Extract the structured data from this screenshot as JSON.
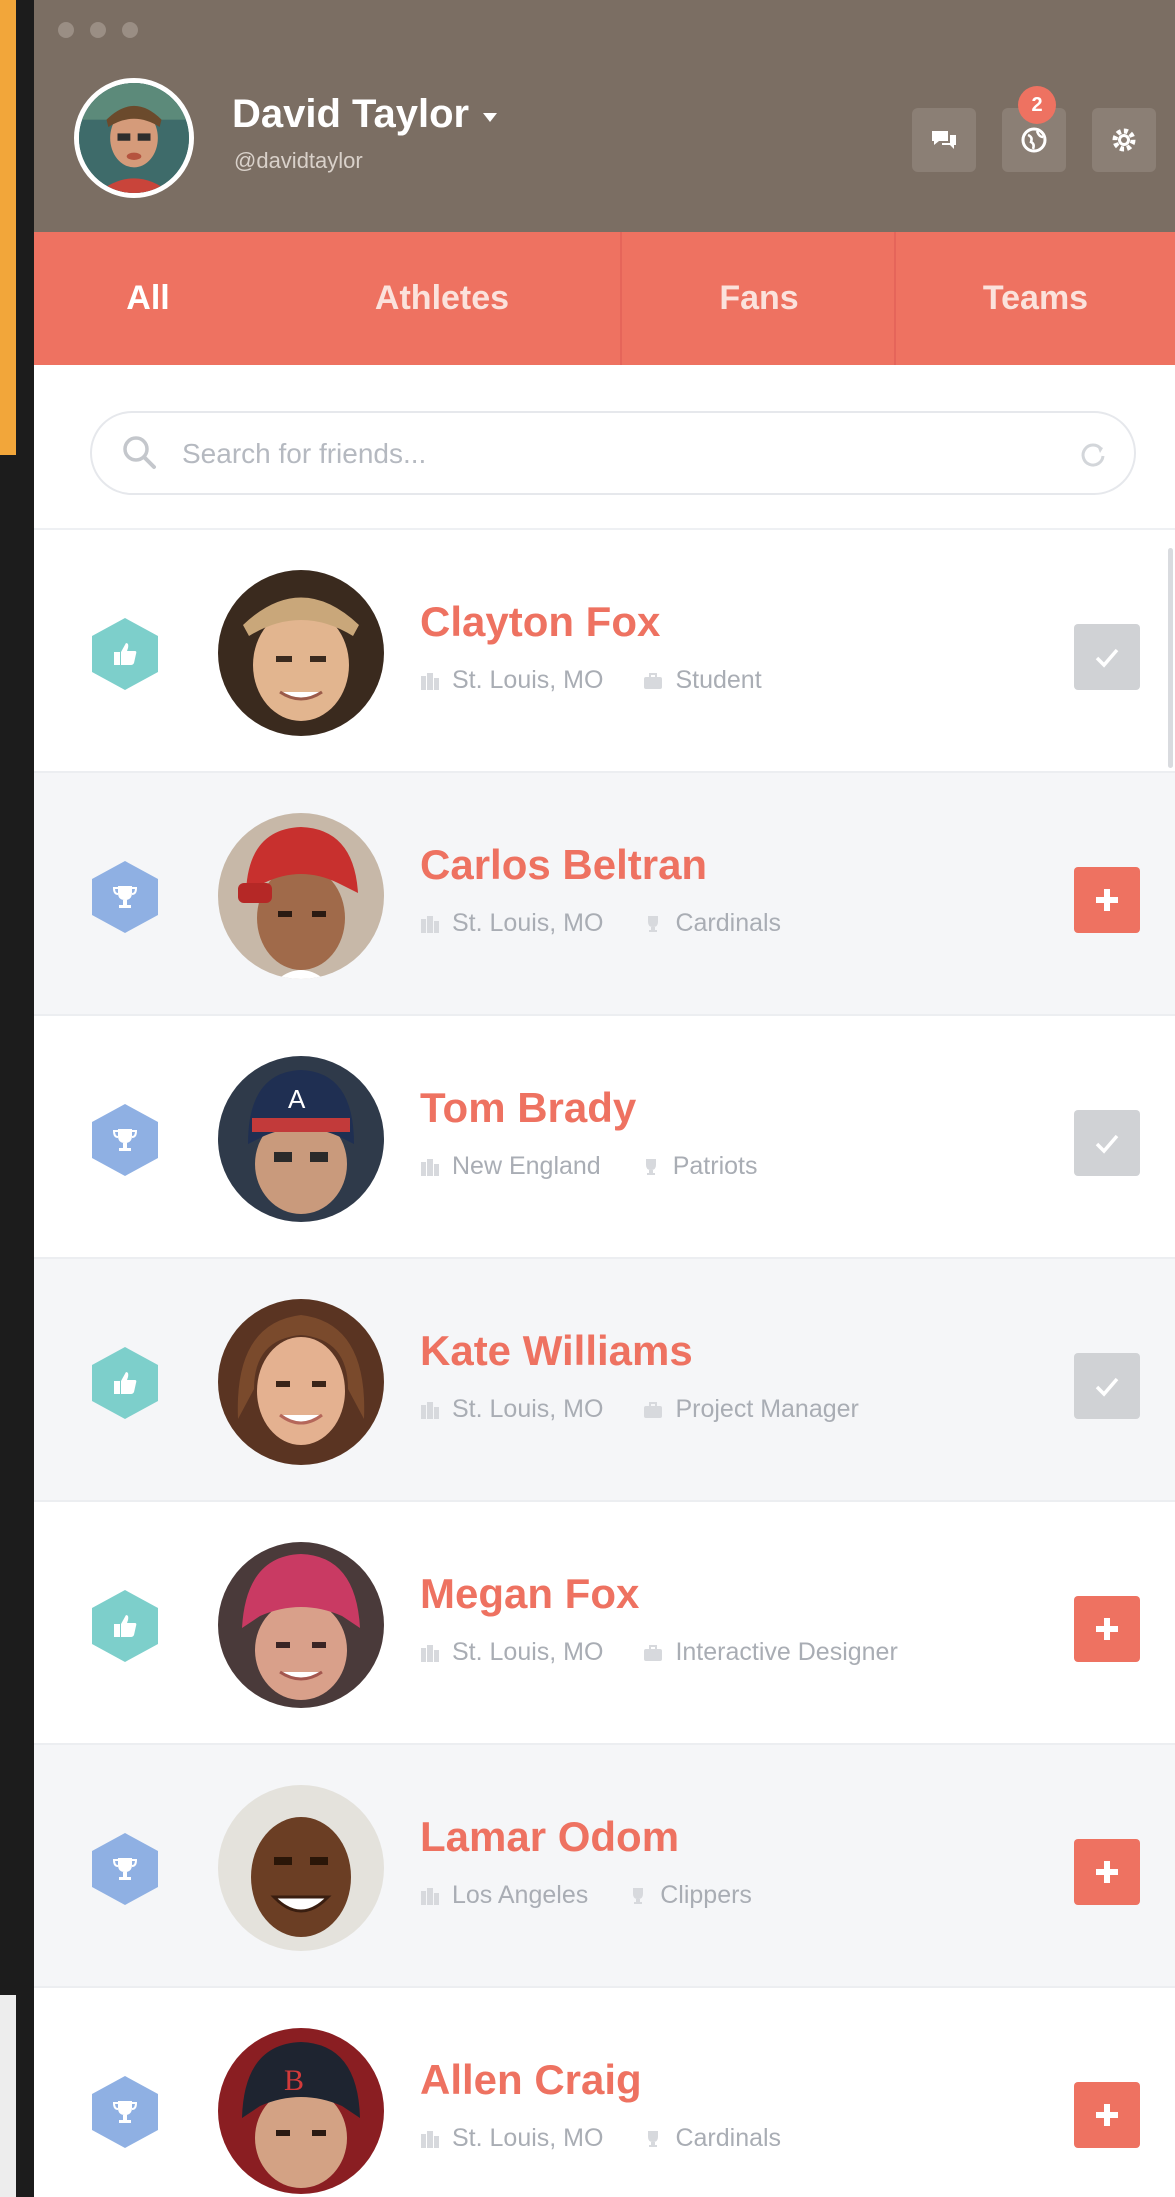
{
  "header": {
    "user_name": "David Taylor",
    "user_handle": "@davidtaylor",
    "notification_count": "2",
    "bg_color": "#7b6e63"
  },
  "tabs": [
    {
      "label": "All",
      "active": true
    },
    {
      "label": "Athletes",
      "active": false
    },
    {
      "label": "Fans",
      "active": false
    },
    {
      "label": "Teams",
      "active": false
    }
  ],
  "search": {
    "placeholder": "Search for friends..."
  },
  "people": [
    {
      "name": "Clayton Fox",
      "location": "St. Louis, MO",
      "detail": "Student",
      "type": "fan",
      "status": "added"
    },
    {
      "name": "Carlos Beltran",
      "location": "St. Louis, MO",
      "detail": "Cardinals",
      "type": "athlete",
      "status": "add"
    },
    {
      "name": "Tom Brady",
      "location": "New England",
      "detail": "Patriots",
      "type": "athlete",
      "status": "added"
    },
    {
      "name": "Kate Williams",
      "location": "St. Louis, MO",
      "detail": "Project Manager",
      "type": "fan",
      "status": "added"
    },
    {
      "name": "Megan Fox",
      "location": "St. Louis, MO",
      "detail": "Interactive Designer",
      "type": "fan",
      "status": "add"
    },
    {
      "name": "Lamar Odom",
      "location": "Los Angeles",
      "detail": "Clippers",
      "type": "athlete",
      "status": "add"
    },
    {
      "name": "Allen Craig",
      "location": "St. Louis, MO",
      "detail": "Cardinals",
      "type": "athlete",
      "status": "add"
    }
  ],
  "colors": {
    "accent": "#ee7261",
    "fan_badge": "#7dcfcb",
    "athlete_badge": "#8fb0e3",
    "added_button": "#d0d2d5"
  }
}
